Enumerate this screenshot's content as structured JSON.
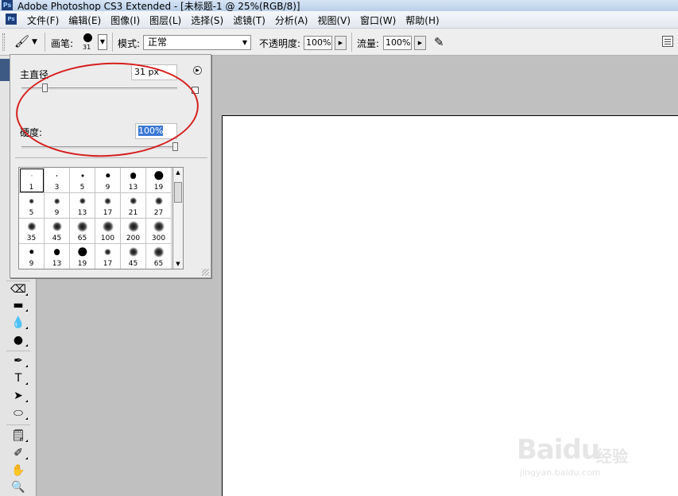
{
  "window": {
    "app_icon": "Ps",
    "title": "Adobe Photoshop CS3 Extended - [未标题-1 @ 25%(RGB/8)]"
  },
  "menubar": {
    "items": [
      "文件(F)",
      "编辑(E)",
      "图像(I)",
      "图层(L)",
      "选择(S)",
      "滤镜(T)",
      "分析(A)",
      "视图(V)",
      "窗口(W)",
      "帮助(H)"
    ]
  },
  "options": {
    "brush_label": "画笔:",
    "brush_size": "31",
    "mode_label": "模式:",
    "mode_value": "正常",
    "opacity_label": "不透明度:",
    "opacity_value": "100%",
    "flow_label": "流量:",
    "flow_value": "100%"
  },
  "brush_popup": {
    "diameter_label": "主直径",
    "diameter_value": "31 px",
    "hardness_label": "硬度:",
    "hardness_value": "100%",
    "presets": [
      {
        "size": "1",
        "soft": false
      },
      {
        "size": "3",
        "soft": false
      },
      {
        "size": "5",
        "soft": false
      },
      {
        "size": "9",
        "soft": false
      },
      {
        "size": "13",
        "soft": false
      },
      {
        "size": "19",
        "soft": false
      },
      {
        "size": "5",
        "soft": true
      },
      {
        "size": "9",
        "soft": true
      },
      {
        "size": "13",
        "soft": true
      },
      {
        "size": "17",
        "soft": true
      },
      {
        "size": "21",
        "soft": true
      },
      {
        "size": "27",
        "soft": true
      },
      {
        "size": "35",
        "soft": true
      },
      {
        "size": "45",
        "soft": true
      },
      {
        "size": "65",
        "soft": true
      },
      {
        "size": "100",
        "soft": true
      },
      {
        "size": "200",
        "soft": true
      },
      {
        "size": "300",
        "soft": true
      },
      {
        "size": "9",
        "soft": false
      },
      {
        "size": "13",
        "soft": false
      },
      {
        "size": "19",
        "soft": false
      },
      {
        "size": "17",
        "soft": true
      },
      {
        "size": "45",
        "soft": true
      },
      {
        "size": "65",
        "soft": true
      }
    ]
  },
  "watermark": {
    "logo": "Baidu",
    "logo_zh": "经验",
    "url": "jingyan.baidu.com"
  }
}
